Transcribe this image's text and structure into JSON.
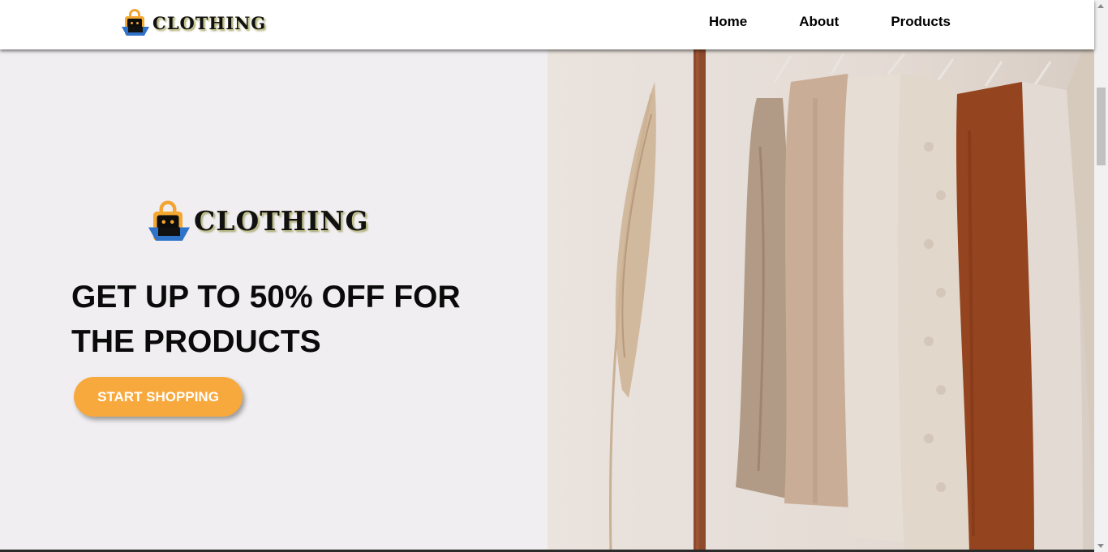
{
  "nav": {
    "logo_text": "CLOTHING",
    "links": [
      "Home",
      "About",
      "Products"
    ]
  },
  "hero": {
    "logo_text": "CLOTHING",
    "headline": "GET UP TO 50% OFF FOR THE PRODUCTS",
    "cta_label": "START SHOPPING"
  },
  "colors": {
    "accent": "#f8a93d",
    "hero_bg": "#f0eef0",
    "logo_bag": "#f4a82f",
    "logo_tray": "#2f73c9"
  },
  "icons": {
    "logo": "shopping-bag-icon",
    "hero_image": "clothing-rack-image"
  }
}
